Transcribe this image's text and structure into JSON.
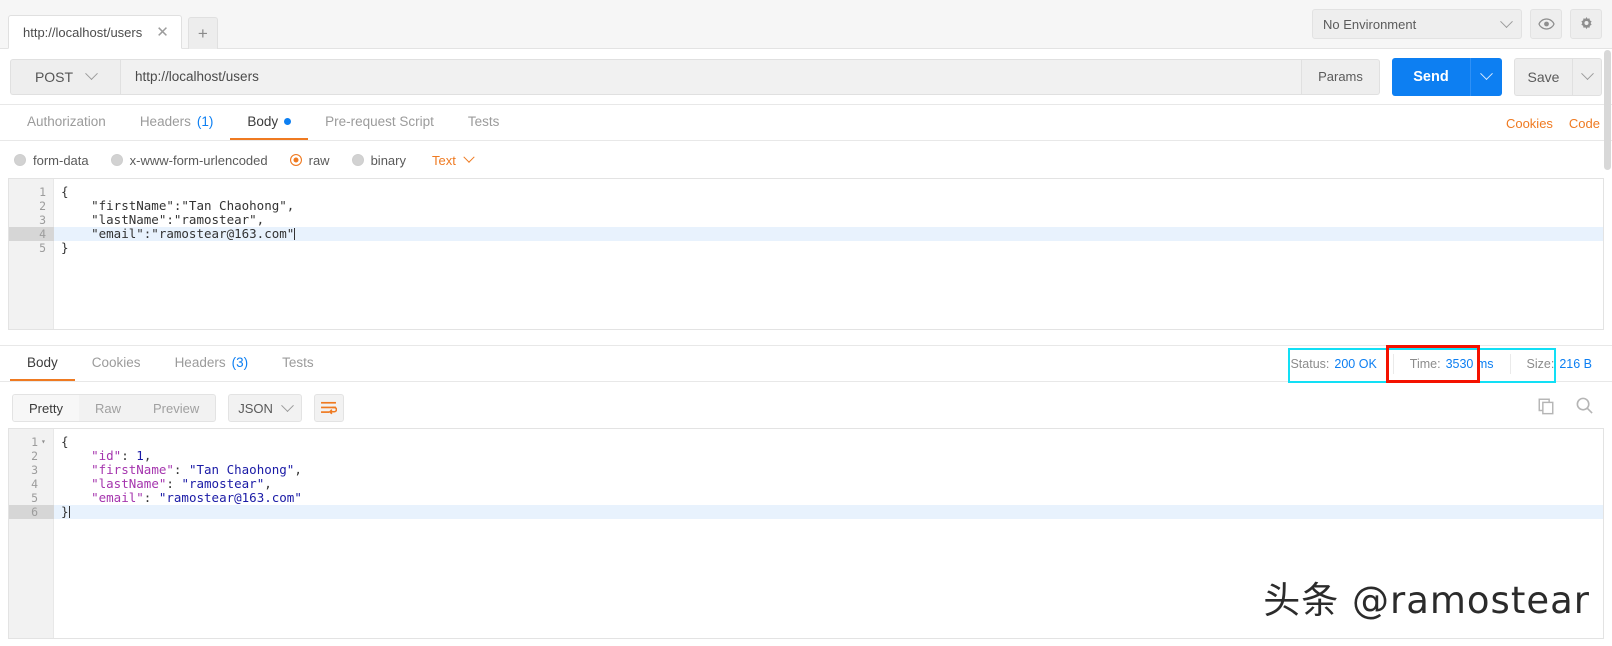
{
  "topbar": {
    "tab_title": "http://localhost/users",
    "tab_close": "✕",
    "new_tab": "+",
    "environment": "No Environment",
    "eye_icon": "eye-icon",
    "gear_icon": "gear-icon"
  },
  "request": {
    "method": "POST",
    "url": "http://localhost/users",
    "params_label": "Params",
    "send_label": "Send",
    "save_label": "Save",
    "tabs": [
      {
        "label": "Authorization",
        "count": "",
        "active": false,
        "dot": false
      },
      {
        "label": "Headers",
        "count": "(1)",
        "active": false,
        "dot": false
      },
      {
        "label": "Body",
        "count": "",
        "active": true,
        "dot": true
      },
      {
        "label": "Pre-request Script",
        "count": "",
        "active": false,
        "dot": false
      },
      {
        "label": "Tests",
        "count": "",
        "active": false,
        "dot": false
      }
    ],
    "links": {
      "cookies": "Cookies",
      "code": "Code"
    },
    "body_types": [
      {
        "label": "form-data",
        "selected": false
      },
      {
        "label": "x-www-form-urlencoded",
        "selected": false
      },
      {
        "label": "raw",
        "selected": true
      },
      {
        "label": "binary",
        "selected": false
      }
    ],
    "raw_format": "Text",
    "body_lines": [
      {
        "n": "1",
        "text": "{",
        "highlight": false
      },
      {
        "n": "2",
        "text": "    \"firstName\":\"Tan Chaohong\",",
        "highlight": false
      },
      {
        "n": "3",
        "text": "    \"lastName\":\"ramostear\",",
        "highlight": false
      },
      {
        "n": "4",
        "text": "    \"email\":\"ramostear@163.com\"",
        "highlight": true,
        "caret": true
      },
      {
        "n": "5",
        "text": "}",
        "highlight": false
      }
    ]
  },
  "response": {
    "tabs": [
      {
        "label": "Body",
        "count": "",
        "active": true
      },
      {
        "label": "Cookies",
        "count": "",
        "active": false
      },
      {
        "label": "Headers",
        "count": "(3)",
        "active": false
      },
      {
        "label": "Tests",
        "count": "",
        "active": false
      }
    ],
    "status": {
      "status_label": "Status:",
      "status_value": "200 OK",
      "time_label": "Time:",
      "time_value": "3530 ms",
      "size_label": "Size:",
      "size_value": "216 B"
    },
    "highlights": {
      "outer_color": "#12dff5",
      "time_color": "#f41200"
    },
    "view_modes": [
      {
        "label": "Pretty",
        "active": true
      },
      {
        "label": "Raw",
        "active": false
      },
      {
        "label": "Preview",
        "active": false
      }
    ],
    "format": "JSON",
    "wrap_icon": "word-wrap-icon",
    "copy_icon": "copy-icon",
    "search_icon": "search-icon",
    "body_lines": [
      {
        "n": "1",
        "fold": "▾",
        "highlight": false,
        "tokens": [
          {
            "t": "{",
            "c": "p"
          }
        ]
      },
      {
        "n": "2",
        "fold": "",
        "highlight": false,
        "tokens": [
          {
            "t": "    ",
            "c": "p"
          },
          {
            "t": "\"id\"",
            "c": "k"
          },
          {
            "t": ": ",
            "c": "p"
          },
          {
            "t": "1",
            "c": "n"
          },
          {
            "t": ",",
            "c": "p"
          }
        ]
      },
      {
        "n": "3",
        "fold": "",
        "highlight": false,
        "tokens": [
          {
            "t": "    ",
            "c": "p"
          },
          {
            "t": "\"firstName\"",
            "c": "k"
          },
          {
            "t": ": ",
            "c": "p"
          },
          {
            "t": "\"Tan Chaohong\"",
            "c": "s"
          },
          {
            "t": ",",
            "c": "p"
          }
        ]
      },
      {
        "n": "4",
        "fold": "",
        "highlight": false,
        "tokens": [
          {
            "t": "    ",
            "c": "p"
          },
          {
            "t": "\"lastName\"",
            "c": "k"
          },
          {
            "t": ": ",
            "c": "p"
          },
          {
            "t": "\"ramostear\"",
            "c": "s"
          },
          {
            "t": ",",
            "c": "p"
          }
        ]
      },
      {
        "n": "5",
        "fold": "",
        "highlight": false,
        "tokens": [
          {
            "t": "    ",
            "c": "p"
          },
          {
            "t": "\"email\"",
            "c": "k"
          },
          {
            "t": ": ",
            "c": "p"
          },
          {
            "t": "\"ramostear@163.com\"",
            "c": "s"
          }
        ]
      },
      {
        "n": "6",
        "fold": "",
        "highlight": true,
        "caret": true,
        "tokens": [
          {
            "t": "}",
            "c": "p"
          }
        ]
      }
    ]
  },
  "watermark": {
    "text": "头条 @ramostear"
  }
}
